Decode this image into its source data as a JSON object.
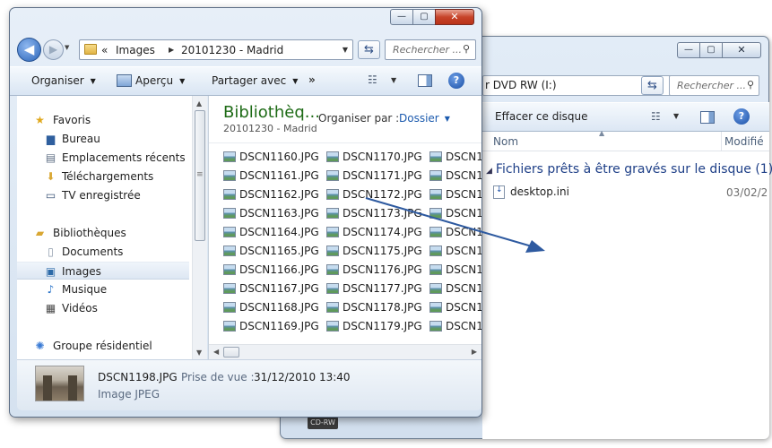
{
  "back_window": {
    "address_text": "r DVD RW (I:)",
    "search_placeholder": "Rechercher ...",
    "toolbar_erase": "Effacer ce disque",
    "help_glyph": "?",
    "columns": {
      "name": "Nom",
      "modified": "Modifié"
    },
    "group_label": "Fichiers prêts à être gravés sur le disque (1)",
    "file_name": "desktop.ini",
    "file_date": "03/02/2",
    "drive_badge": "CD-RW",
    "caption": {
      "min": "—",
      "max": "▢",
      "close": "✕"
    }
  },
  "front_window": {
    "caption": {
      "min": "—",
      "max": "▢",
      "close": "✕"
    },
    "nav": {
      "back": "◀",
      "forward": "▶"
    },
    "address": {
      "root": "«",
      "part1": "Images",
      "part2": "20101230 - Madrid"
    },
    "search_placeholder": "Rechercher ...",
    "toolbar": {
      "organize": "Organiser",
      "preview": "Aperçu",
      "share": "Partager avec",
      "more": "»",
      "help_glyph": "?"
    },
    "sidebar": {
      "favorites": "Favoris",
      "desktop": "Bureau",
      "recent": "Emplacements récents",
      "downloads": "Téléchargements",
      "tv": "TV enregistrée",
      "libraries": "Bibliothèques",
      "documents": "Documents",
      "images": "Images",
      "music": "Musique",
      "videos": "Vidéos",
      "homegroup": "Groupe résidentiel"
    },
    "library": {
      "title": "Bibliothèq...",
      "subtitle": "20101230 - Madrid",
      "arrange_label": "Organiser par :",
      "arrange_value": "Dossier"
    },
    "files": {
      "col1": [
        "DSCN1160.JPG",
        "DSCN1161.JPG",
        "DSCN1162.JPG",
        "DSCN1163.JPG",
        "DSCN1164.JPG",
        "DSCN1165.JPG",
        "DSCN1166.JPG",
        "DSCN1167.JPG",
        "DSCN1168.JPG",
        "DSCN1169.JPG"
      ],
      "col2": [
        "DSCN1170.JPG",
        "DSCN1171.JPG",
        "DSCN1172.JPG",
        "DSCN1173.JPG",
        "DSCN1174.JPG",
        "DSCN1175.JPG",
        "DSCN1176.JPG",
        "DSCN1177.JPG",
        "DSCN1178.JPG",
        "DSCN1179.JPG"
      ],
      "col3": [
        "DSCN1",
        "DSCN1",
        "DSCN1",
        "DSCN1",
        "DSCN1",
        "DSCN1",
        "DSCN1",
        "DSCN1",
        "DSCN1",
        "DSCN1"
      ]
    },
    "details": {
      "file_name": "DSCN1198.JPG",
      "property_label": "Prise de vue :",
      "property_value": "31/12/2010 13:40",
      "file_type": "Image JPEG"
    }
  }
}
